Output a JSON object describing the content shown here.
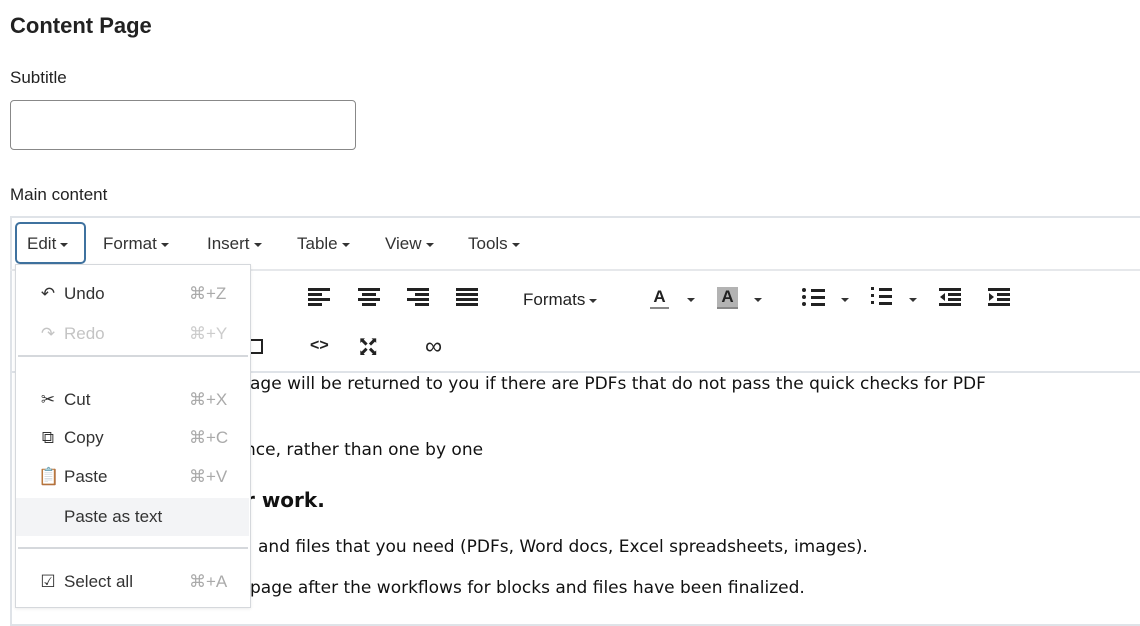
{
  "page": {
    "title": "Content Page"
  },
  "form": {
    "subtitle_label": "Subtitle",
    "subtitle_value": "",
    "main_content_label": "Main content"
  },
  "editor": {
    "menubar": [
      {
        "label": "Edit"
      },
      {
        "label": "Format"
      },
      {
        "label": "Insert"
      },
      {
        "label": "Table"
      },
      {
        "label": "View"
      },
      {
        "label": "Tools"
      }
    ],
    "toolbar": {
      "formats_label": "Formats",
      "text_color_glyph": "A",
      "bg_color_glyph": "A",
      "icons": [
        "underline-icon",
        "align-left-icon",
        "align-center-icon",
        "align-right-icon",
        "align-justify-icon",
        "text-color-icon",
        "background-color-icon",
        "bullet-list-icon",
        "numbered-list-icon",
        "outdent-icon",
        "indent-icon",
        "media-icon",
        "code-icon",
        "fullscreen-icon",
        "link-icon"
      ],
      "code_glyph": "<>",
      "link_glyph": "∞"
    },
    "edit_menu": [
      {
        "label": "Undo",
        "shortcut": "⌘+Z",
        "icon": "undo-icon",
        "disabled": false
      },
      {
        "label": "Redo",
        "shortcut": "⌘+Y",
        "icon": "redo-icon",
        "disabled": true
      },
      {
        "label": "Cut",
        "shortcut": "⌘+X",
        "icon": "cut-icon",
        "disabled": false
      },
      {
        "label": "Copy",
        "shortcut": "⌘+C",
        "icon": "copy-icon",
        "disabled": false
      },
      {
        "label": "Paste",
        "shortcut": "⌘+V",
        "icon": "paste-icon",
        "disabled": false
      },
      {
        "label": "Paste as text",
        "shortcut": "",
        "icon": "",
        "disabled": false,
        "highlighted": true
      },
      {
        "label": "Select all",
        "shortcut": "⌘+A",
        "icon": "checkbox-icon",
        "disabled": false
      }
    ],
    "content_visible": [
      "age will be returned to you if there are PDFs that do not pass the quick checks for PDF",
      "nce, rather than one by one",
      "r work.",
      "and files that you need (PDFs, Word docs, Excel spreadsheets, images).",
      "page after the workflows for blocks and files have been finalized."
    ]
  },
  "colors": {
    "focus_border": "#3f729f",
    "highlight_bg": "#b3b3b3",
    "disabled_text": "#c4c4c4"
  }
}
